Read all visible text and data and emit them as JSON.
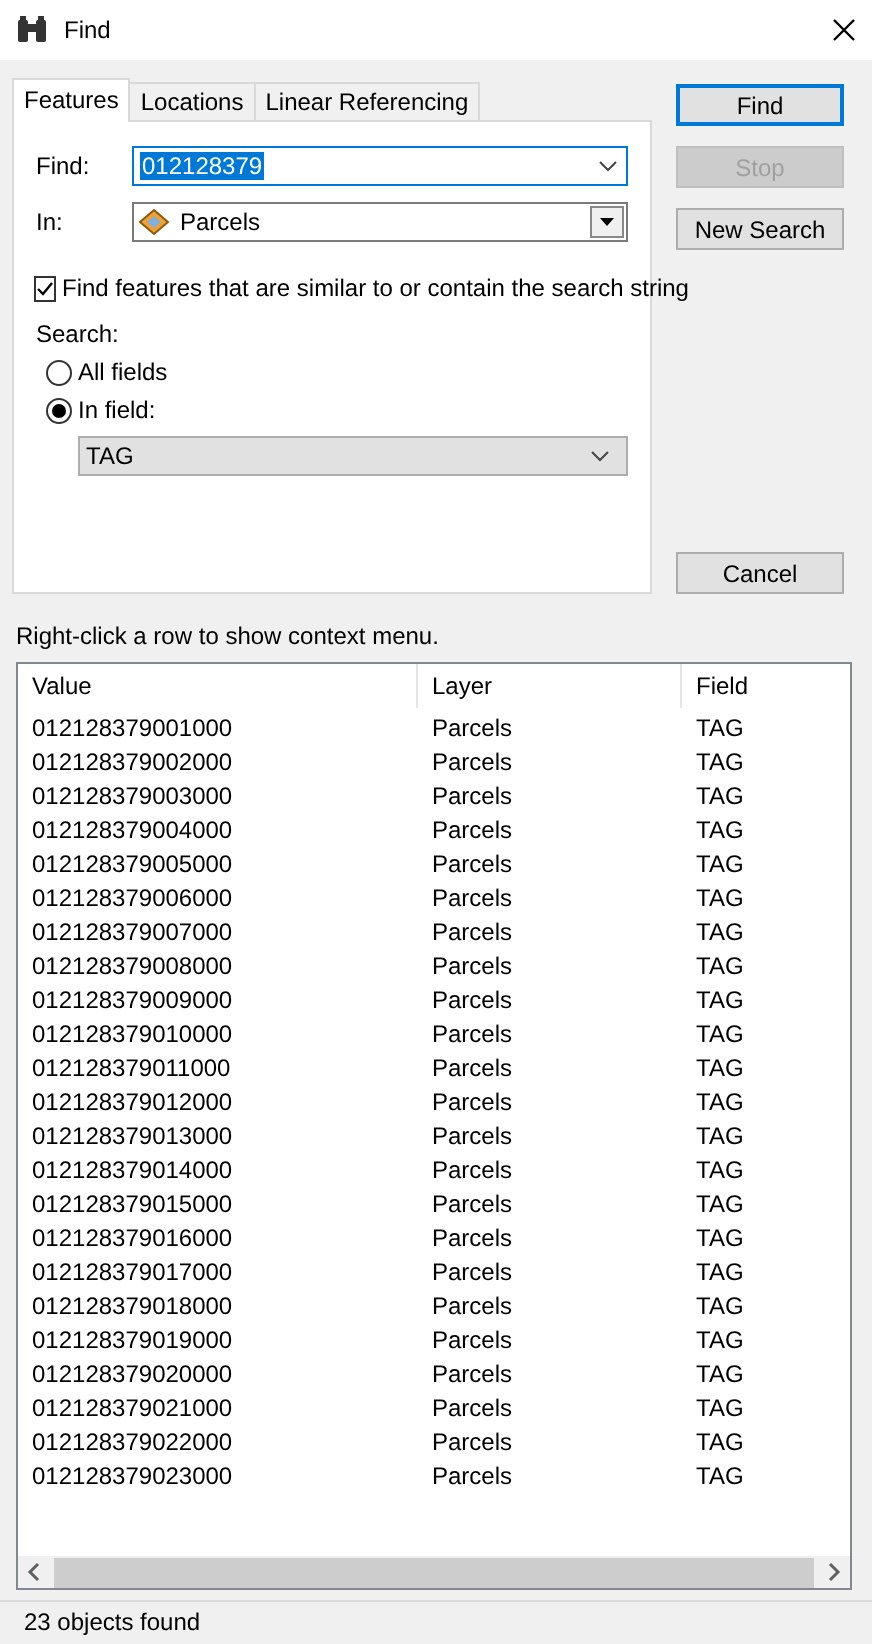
{
  "window": {
    "title": "Find"
  },
  "tabs": [
    {
      "label": "Features",
      "selected": true
    },
    {
      "label": "Locations",
      "selected": false
    },
    {
      "label": "Linear Referencing",
      "selected": false
    }
  ],
  "find_field": {
    "label": "Find:",
    "value": "012128379",
    "focused": true
  },
  "in_field": {
    "label": "In:",
    "value": "Parcels"
  },
  "similar_checkbox": {
    "label": "Find features that are similar to or contain the search string",
    "checked": true
  },
  "search": {
    "label": "Search:",
    "options": [
      {
        "label": "All fields",
        "selected": false
      },
      {
        "label": "In field:",
        "selected": true
      }
    ],
    "field_dropdown": {
      "value": "TAG"
    }
  },
  "buttons": [
    {
      "label": "Find",
      "default": true,
      "disabled": false
    },
    {
      "label": "Stop",
      "default": false,
      "disabled": true
    },
    {
      "label": "New Search",
      "default": false,
      "disabled": false
    },
    {
      "label": "Cancel",
      "default": false,
      "disabled": false
    }
  ],
  "hint": "Right-click a row to show context menu.",
  "results": {
    "columns": [
      "Value",
      "Layer",
      "Field"
    ],
    "rows": [
      {
        "value": "012128379001000",
        "layer": "Parcels",
        "field": "TAG"
      },
      {
        "value": "012128379002000",
        "layer": "Parcels",
        "field": "TAG"
      },
      {
        "value": "012128379003000",
        "layer": "Parcels",
        "field": "TAG"
      },
      {
        "value": "012128379004000",
        "layer": "Parcels",
        "field": "TAG"
      },
      {
        "value": "012128379005000",
        "layer": "Parcels",
        "field": "TAG"
      },
      {
        "value": "012128379006000",
        "layer": "Parcels",
        "field": "TAG"
      },
      {
        "value": "012128379007000",
        "layer": "Parcels",
        "field": "TAG"
      },
      {
        "value": "012128379008000",
        "layer": "Parcels",
        "field": "TAG"
      },
      {
        "value": "012128379009000",
        "layer": "Parcels",
        "field": "TAG"
      },
      {
        "value": "012128379010000",
        "layer": "Parcels",
        "field": "TAG"
      },
      {
        "value": "012128379011000",
        "layer": "Parcels",
        "field": "TAG"
      },
      {
        "value": "012128379012000",
        "layer": "Parcels",
        "field": "TAG"
      },
      {
        "value": "012128379013000",
        "layer": "Parcels",
        "field": "TAG"
      },
      {
        "value": "012128379014000",
        "layer": "Parcels",
        "field": "TAG"
      },
      {
        "value": "012128379015000",
        "layer": "Parcels",
        "field": "TAG"
      },
      {
        "value": "012128379016000",
        "layer": "Parcels",
        "field": "TAG"
      },
      {
        "value": "012128379017000",
        "layer": "Parcels",
        "field": "TAG"
      },
      {
        "value": "012128379018000",
        "layer": "Parcels",
        "field": "TAG"
      },
      {
        "value": "012128379019000",
        "layer": "Parcels",
        "field": "TAG"
      },
      {
        "value": "012128379020000",
        "layer": "Parcels",
        "field": "TAG"
      },
      {
        "value": "012128379021000",
        "layer": "Parcels",
        "field": "TAG"
      },
      {
        "value": "012128379022000",
        "layer": "Parcels",
        "field": "TAG"
      },
      {
        "value": "012128379023000",
        "layer": "Parcels",
        "field": "TAG"
      }
    ]
  },
  "status_bar": "23 objects found"
}
